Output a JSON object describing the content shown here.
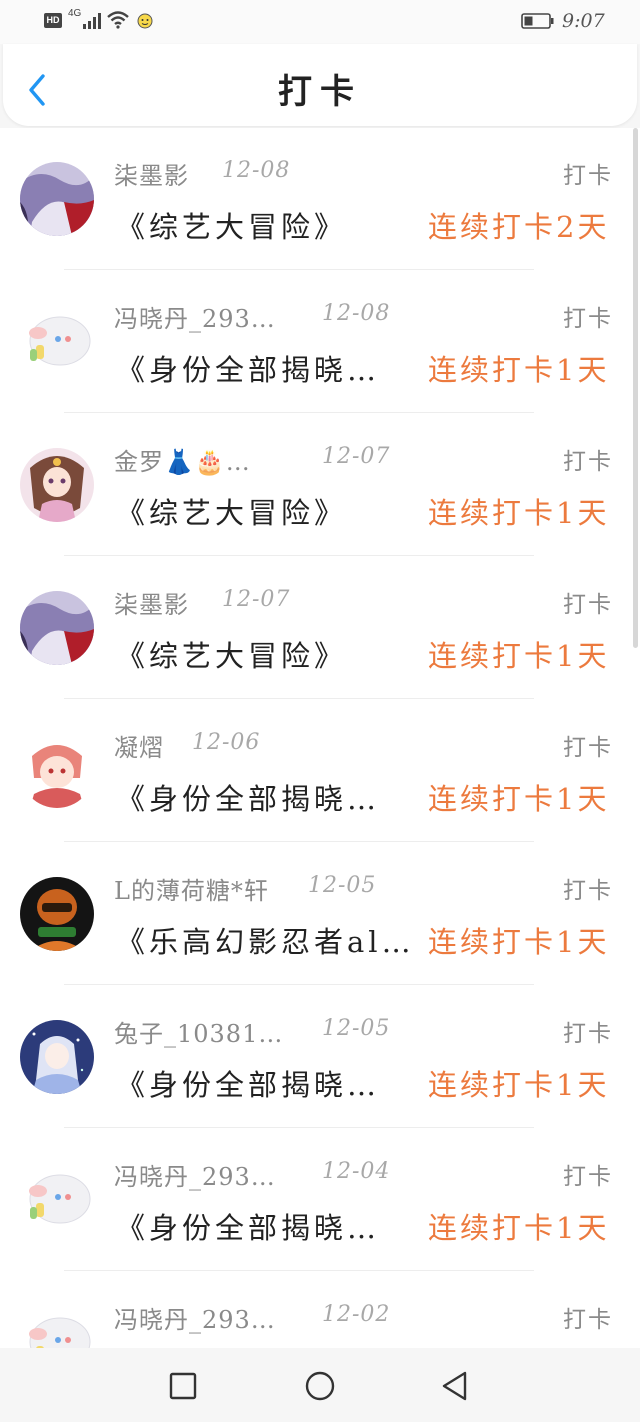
{
  "status_bar": {
    "hd_badge": "HD",
    "network": "4G",
    "time": "9:07",
    "icons": [
      "signal-icon",
      "wifi-icon",
      "emoji-icon",
      "battery-icon"
    ]
  },
  "header": {
    "title": "打卡",
    "back_icon": "chevron-left-icon",
    "accent_color": "#2196f3"
  },
  "streak_color": "#ec7a3e",
  "checkins": [
    {
      "user": "柒墨影",
      "date": "12-08",
      "tag": "打卡",
      "book": "《综艺大冒险》",
      "streak": "连续打卡2天"
    },
    {
      "user": "冯晓丹_293…",
      "date": "12-08",
      "tag": "打卡",
      "book": "《身份全部揭晓…",
      "streak": "连续打卡1天"
    },
    {
      "user": "金罗👗🎂…",
      "date": "12-07",
      "tag": "打卡",
      "book": "《综艺大冒险》",
      "streak": "连续打卡1天"
    },
    {
      "user": "柒墨影",
      "date": "12-07",
      "tag": "打卡",
      "book": "《综艺大冒险》",
      "streak": "连续打卡1天"
    },
    {
      "user": "凝熠",
      "date": "12-06",
      "tag": "打卡",
      "book": "《身份全部揭晓…",
      "streak": "连续打卡1天"
    },
    {
      "user": "L的薄荷糖*轩",
      "date": "12-05",
      "tag": "打卡",
      "book": "《乐高幻影忍者al…",
      "streak": "连续打卡1天"
    },
    {
      "user": "兔子_10381…",
      "date": "12-05",
      "tag": "打卡",
      "book": "《身份全部揭晓…",
      "streak": "连续打卡1天"
    },
    {
      "user": "冯晓丹_293…",
      "date": "12-04",
      "tag": "打卡",
      "book": "《身份全部揭晓…",
      "streak": "连续打卡1天"
    },
    {
      "user": "冯晓丹_293…",
      "date": "12-02",
      "tag": "打卡",
      "book": "",
      "streak": ""
    }
  ],
  "nav_bar": {
    "icons": [
      "recent-apps-icon",
      "home-icon",
      "back-triangle-icon"
    ]
  }
}
